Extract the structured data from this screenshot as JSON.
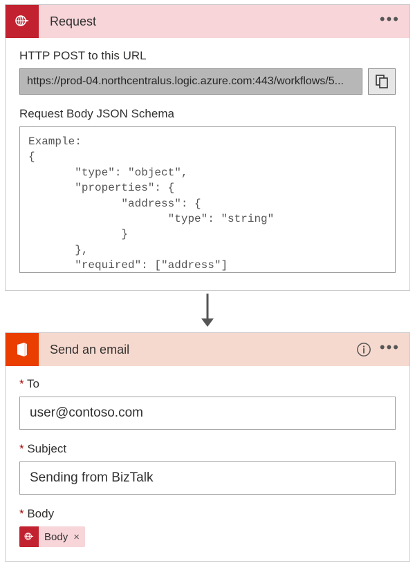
{
  "request": {
    "title": "Request",
    "url_label": "HTTP POST to this URL",
    "url_value": "https://prod-04.northcentralus.logic.azure.com:443/workflows/5...",
    "schema_label": "Request Body JSON Schema",
    "schema_value": "Example:\n{\n       \"type\": \"object\",\n       \"properties\": {\n              \"address\": {\n                     \"type\": \"string\"\n              }\n       },\n       \"required\": [\"address\"]\n}"
  },
  "email": {
    "title": "Send an email",
    "to_label": "To",
    "to_value": "user@contoso.com",
    "subject_label": "Subject",
    "subject_value": "Sending from BizTalk",
    "body_label": "Body",
    "body_token": "Body"
  }
}
